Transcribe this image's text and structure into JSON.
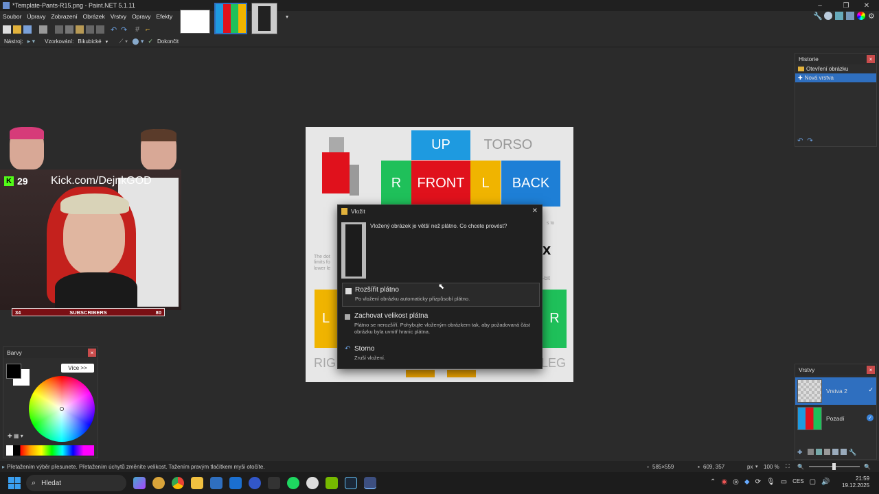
{
  "window": {
    "title": "*Template-Pants-R15.png - Paint.NET 5.1.11"
  },
  "menu": [
    "Soubor",
    "Úpravy",
    "Zobrazení",
    "Obrázek",
    "Vrstvy",
    "Opravy",
    "Efekty"
  ],
  "tools_bar": {
    "tool_label": "Nástroj:",
    "sampling_label": "Vzorkování:",
    "sampling_value": "Bikubické",
    "finish_label": "Dokončit"
  },
  "history": {
    "title": "Historie",
    "items": [
      "Otevření obrázku",
      "Nová vrstva"
    ]
  },
  "layers": {
    "title": "Vrstvy",
    "items": [
      "Vrstva 2",
      "Pozadí"
    ]
  },
  "colors": {
    "title": "Barvy",
    "more_button": "Více >>"
  },
  "template": {
    "up": "UP",
    "torso": "TORSO",
    "r": "R",
    "front": "FRONT",
    "l": "L",
    "back": "BACK",
    "l2": "L",
    "r2": "R",
    "rig": "RIG",
    "leg": "LEG",
    "x": "x",
    "note_left": "The dot\nlimits fo\nlower le",
    "note_right": "-bit",
    "note_top": "s to"
  },
  "dialog": {
    "title": "Vložit",
    "question": "Vložený obrázek je větší než plátno. Co chcete provést?",
    "options": [
      {
        "main": "Rozšířit plátno",
        "sub": "Po vložení obrázku automaticky přizpůsobí plátno."
      },
      {
        "main": "Zachovat velikost plátna",
        "sub": "Plátno se nerozšíří. Pohybujte vloženým obrázkem tak, aby požadovaná část obrázku byla uvnitř hranic plátna."
      },
      {
        "main": "Storno",
        "sub": "Zruší vložení."
      }
    ]
  },
  "stream": {
    "kick_count": "29",
    "kick_url": "Kick.com/DejnkGOD",
    "subs_left": "34",
    "subs_label": "SUBSCRIBERS",
    "subs_right": "80"
  },
  "status": {
    "hint": "Přetažením výběr přesunete. Přetažením úchytů změníte velikost. Tažením pravým tlačítkem myši otočíte.",
    "size": "585×559",
    "pos": "609, 357",
    "unit": "px",
    "zoom": "100 %"
  },
  "taskbar": {
    "search": "Hledat",
    "lang": "CES",
    "time": "21:59",
    "date": "19.12.2025"
  },
  "colors_theme": {
    "accent": "#2f6fbf",
    "front_red": "#e0111c",
    "blue": "#1e9ae0",
    "green": "#1fc05a",
    "yellow": "#f0b400"
  }
}
